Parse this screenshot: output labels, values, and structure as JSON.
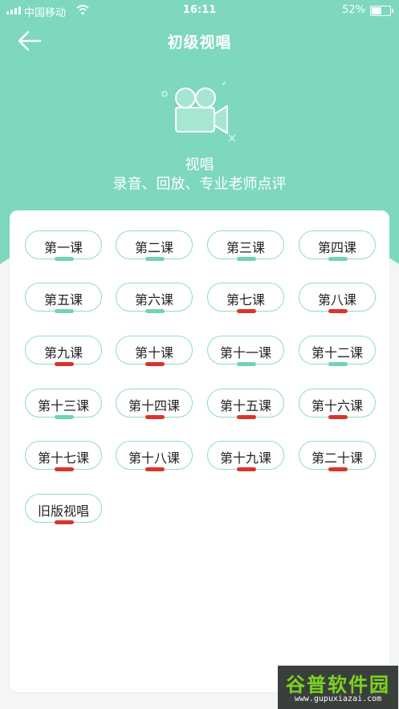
{
  "status_bar": {
    "carrier": "中国移动",
    "time": "16:11",
    "battery": "52%"
  },
  "header": {
    "title": "初级视唱"
  },
  "hero": {
    "title": "视唱",
    "subtitle": "录音、回放、专业老师点评"
  },
  "lessons": [
    {
      "label": "第一课",
      "status": "green"
    },
    {
      "label": "第二课",
      "status": "green"
    },
    {
      "label": "第三课",
      "status": "green"
    },
    {
      "label": "第四课",
      "status": "green"
    },
    {
      "label": "第五课",
      "status": "green"
    },
    {
      "label": "第六课",
      "status": "green"
    },
    {
      "label": "第七课",
      "status": "red"
    },
    {
      "label": "第八课",
      "status": "red"
    },
    {
      "label": "第九课",
      "status": "red"
    },
    {
      "label": "第十课",
      "status": "red"
    },
    {
      "label": "第十一课",
      "status": "green"
    },
    {
      "label": "第十二课",
      "status": "green"
    },
    {
      "label": "第十三课",
      "status": "green"
    },
    {
      "label": "第十四课",
      "status": "red"
    },
    {
      "label": "第十五课",
      "status": "red"
    },
    {
      "label": "第十六课",
      "status": "red"
    },
    {
      "label": "第十七课",
      "status": "red"
    },
    {
      "label": "第十八课",
      "status": "red"
    },
    {
      "label": "第十九课",
      "status": "red"
    },
    {
      "label": "第二十课",
      "status": "red"
    },
    {
      "label": "旧版视唱",
      "status": "red"
    }
  ],
  "watermark": {
    "title": "谷普软件园",
    "url": "www.gupuxiazai.com"
  },
  "colors": {
    "theme": "#7dd8bd",
    "green_marker": "#72d3b5",
    "red_marker": "#d9352b"
  }
}
